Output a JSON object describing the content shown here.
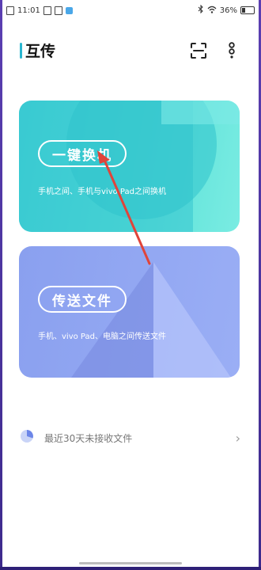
{
  "status_bar": {
    "time": "11:01",
    "battery": "36%",
    "icons": [
      "sim-icon",
      "gallery-icon",
      "app-notification-icon",
      "bluetooth-icon",
      "wifi-icon",
      "battery-icon"
    ]
  },
  "header": {
    "title": "互传",
    "accent_color": "#29b6d0",
    "actions": [
      "scan-icon",
      "more-icon"
    ]
  },
  "cards": [
    {
      "button_label": "一键换机",
      "description": "手机之间、手机与vivo Pad之间换机",
      "color": "#3fd0d6"
    },
    {
      "button_label": "传送文件",
      "description": "手机、vivo Pad、电脑之间传送文件",
      "color": "#8aa0ef"
    }
  ],
  "recent": {
    "label": "最近30天未接收文件",
    "icon": "pie-chart-icon",
    "chevron": "›"
  },
  "annotation": {
    "arrow_color": "#e0443a"
  }
}
